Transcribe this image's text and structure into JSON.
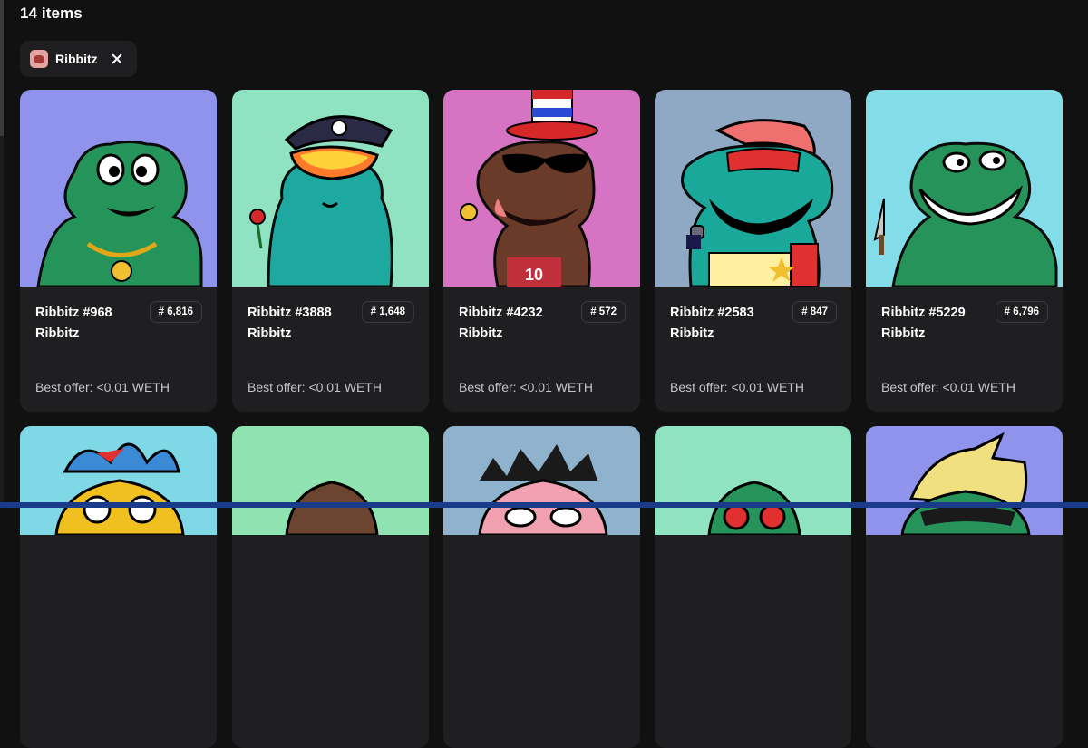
{
  "header": {
    "item_count": "14 items"
  },
  "filter_chip": {
    "label": "Ribbitz",
    "avatar_icon": "ribbitz-avatar"
  },
  "colors": {
    "background": "#111112",
    "card": "#1f1f21",
    "bottom_accent": "#1a3a8a"
  },
  "cards": [
    {
      "name": "Ribbitz #968",
      "rank": "# 6,816",
      "collection": "Ribbitz",
      "offer": "Best offer: <0.01 WETH",
      "bg": "#8f93ec",
      "frog": "#25945a"
    },
    {
      "name": "Ribbitz #3888",
      "rank": "# 1,648",
      "collection": "Ribbitz",
      "offer": "Best offer: <0.01 WETH",
      "bg": "#8fe3c2",
      "frog": "#1da9a0"
    },
    {
      "name": "Ribbitz #4232",
      "rank": "# 572",
      "collection": "Ribbitz",
      "offer": "Best offer: <0.01 WETH",
      "bg": "#d673c2",
      "frog": "#6b3b2a"
    },
    {
      "name": "Ribbitz #2583",
      "rank": "# 847",
      "collection": "Ribbitz",
      "offer": "Best offer: <0.01 WETH",
      "bg": "#8fa9c4",
      "frog": "#1aa89b"
    },
    {
      "name": "Ribbitz #5229",
      "rank": "# 6,796",
      "collection": "Ribbitz",
      "offer": "Best offer: <0.01 WETH",
      "bg": "#83dde8",
      "frog": "#26945a"
    }
  ],
  "partial_cards": [
    {
      "bg": "#7fd8e6"
    },
    {
      "bg": "#8fe3b0"
    },
    {
      "bg": "#8fb3cc"
    },
    {
      "bg": "#8fe3c0"
    },
    {
      "bg": "#8f93ec"
    }
  ]
}
